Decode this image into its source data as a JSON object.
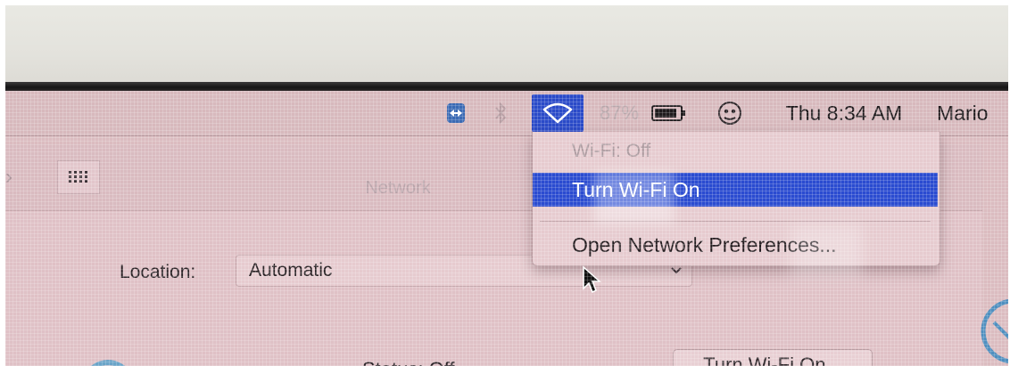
{
  "menubar": {
    "battery_percent": "87%",
    "clock": "Thu 8:34 AM",
    "user_name": "Mario",
    "icons": [
      "teamviewer-icon",
      "bluetooth-icon",
      "wifi-icon",
      "battery-icon",
      "user-icon"
    ]
  },
  "wifi_menu": {
    "status": "Wi-Fi: Off",
    "turn_on": "Turn Wi-Fi On",
    "open_prefs": "Open Network Preferences..."
  },
  "prefs_window": {
    "title": "Network",
    "location_label": "Location:",
    "location_value": "Automatic",
    "status_text": "Status: Off",
    "turn_on_button": "Turn Wi-Fi On..."
  },
  "colors": {
    "highlight": "#2a4bd0",
    "screen_tint": "#dbbcc0"
  }
}
